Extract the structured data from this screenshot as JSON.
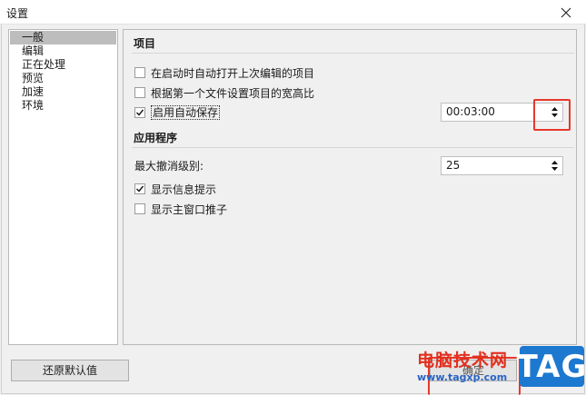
{
  "window": {
    "title": "设置"
  },
  "sidebar": {
    "items": [
      {
        "label": "一般",
        "selected": true
      },
      {
        "label": "编辑",
        "selected": false
      },
      {
        "label": "正在处理",
        "selected": false
      },
      {
        "label": "预览",
        "selected": false
      },
      {
        "label": "加速",
        "selected": false
      },
      {
        "label": "环境",
        "selected": false
      }
    ]
  },
  "project_section": {
    "heading": "项目",
    "open_last_project": {
      "label": "在启动时自动打开上次编辑的项目",
      "checked": false
    },
    "aspect_from_first_file": {
      "label": "根据第一个文件设置项目的宽高比",
      "checked": false
    },
    "auto_save": {
      "label": "启用自动保存",
      "checked": true,
      "interval": "00:03:00"
    }
  },
  "app_section": {
    "heading": "应用程序",
    "max_undo_label": "最大撤消级别:",
    "max_undo_value": "25",
    "show_tooltips": {
      "label": "显示信息提示",
      "checked": true
    },
    "show_main_pusher": {
      "label": "显示主窗口推子",
      "checked": false
    }
  },
  "buttons": {
    "restore_defaults": "还原默认值",
    "ok": "确定"
  },
  "watermark": {
    "site_name": "电脑技术网",
    "url": "www.tagxp.com",
    "logo": "TAG"
  },
  "colors": {
    "highlight_box": "#e8372c",
    "selection": "#bdbdbd",
    "logo_bg": "#1d78d0"
  }
}
